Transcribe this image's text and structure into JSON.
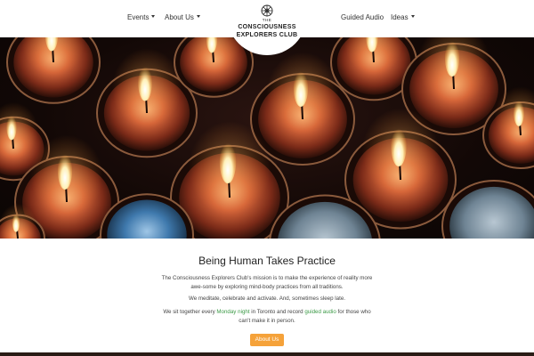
{
  "nav": {
    "left": [
      {
        "label": "Events",
        "has_dropdown": true
      },
      {
        "label": "About Us",
        "has_dropdown": true
      }
    ],
    "right": [
      {
        "label": "Guided Audio",
        "has_dropdown": false
      },
      {
        "label": "Ideas",
        "has_dropdown": true
      }
    ]
  },
  "logo": {
    "the": "THE",
    "line1": "CONSCIOUSNESS",
    "line2": "EXPLORERS CLUB",
    "icon": "wheel-icon"
  },
  "hero": {
    "image": "tealight-candles-photo"
  },
  "main": {
    "title": "Being Human Takes Practice",
    "p1": "The Consciousness Explorers Club's mission is to make the experience of reality more awe-some by exploring mind-body practices from all traditions.",
    "p2": "We meditate, celebrate and activate. And, sometimes sleep late.",
    "p3_a": "We sit together every ",
    "p3_link1": "Monday night",
    "p3_b": " in Toronto and record ",
    "p3_link2": "guided audio",
    "p3_c": " for those who can't make it in person.",
    "button": "About Us"
  },
  "colors": {
    "accent_button": "#f5a23a",
    "link_green": "#3c9a47"
  }
}
